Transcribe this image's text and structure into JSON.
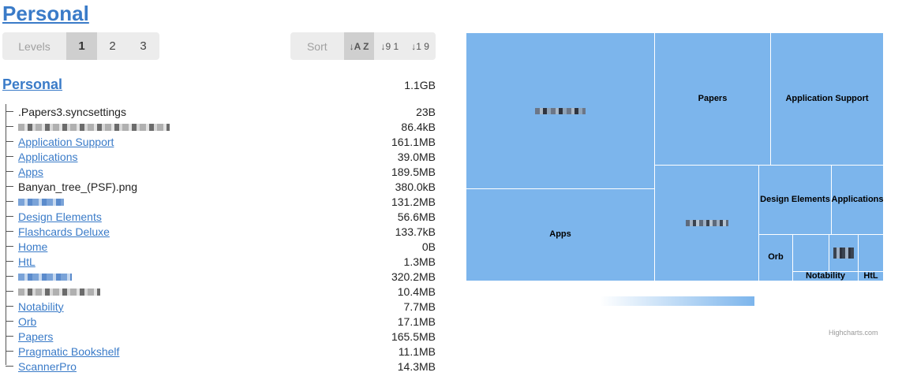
{
  "page": {
    "title": "Personal"
  },
  "levels": {
    "label": "Levels",
    "options": [
      "1",
      "2",
      "3"
    ],
    "active": 0
  },
  "sort": {
    "label": "Sort",
    "options": [
      {
        "icon": "sort-alpha-icon",
        "glyph": "↓A Z",
        "active": true
      },
      {
        "icon": "sort-numeric-asc-icon",
        "glyph": "↓9 1",
        "active": false
      },
      {
        "icon": "sort-numeric-desc-icon",
        "glyph": "↓1 9",
        "active": false
      }
    ]
  },
  "root": {
    "name": "Personal",
    "size": "1.1GB"
  },
  "items": [
    {
      "name": ".Papers3.syncsettings",
      "size": "23B",
      "link": false
    },
    {
      "name": "",
      "size": "86.4kB",
      "link": false,
      "redacted": true
    },
    {
      "name": "Application Support",
      "size": "161.1MB",
      "link": true
    },
    {
      "name": "Applications",
      "size": "39.0MB",
      "link": true
    },
    {
      "name": "Apps",
      "size": "189.5MB",
      "link": true
    },
    {
      "name": "Banyan_tree_(PSF).png",
      "size": "380.0kB",
      "link": false
    },
    {
      "name": "",
      "size": "131.2MB",
      "link": true,
      "redacted": true
    },
    {
      "name": "Design Elements",
      "size": "56.6MB",
      "link": true
    },
    {
      "name": "Flashcards Deluxe",
      "size": "133.7kB",
      "link": true
    },
    {
      "name": "Home",
      "size": "0B",
      "link": true
    },
    {
      "name": "HtL",
      "size": "1.3MB",
      "link": true
    },
    {
      "name": "",
      "size": "320.2MB",
      "link": true,
      "redacted": true
    },
    {
      "name": "",
      "size": "10.4MB",
      "link": false,
      "redacted": true
    },
    {
      "name": "Notability",
      "size": "7.7MB",
      "link": true
    },
    {
      "name": "Orb",
      "size": "17.1MB",
      "link": true
    },
    {
      "name": "Papers",
      "size": "165.5MB",
      "link": true
    },
    {
      "name": "Pragmatic Bookshelf",
      "size": "11.1MB",
      "link": true
    },
    {
      "name": "ScannerPro",
      "size": "14.3MB",
      "link": true
    }
  ],
  "treemap": {
    "color": "#7cb5ec",
    "labels": {
      "papers": "Papers",
      "application_support": "Application Support",
      "apps": "Apps",
      "design_elements": "Design Elements",
      "applications": "Applications",
      "orb": "Orb",
      "notability": "Notability",
      "htl": "HtL"
    }
  },
  "credits": "Highcharts.com"
}
